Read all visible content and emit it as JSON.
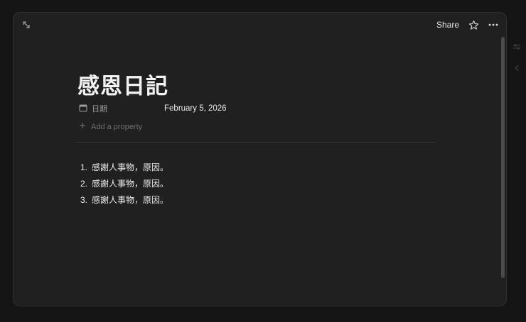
{
  "page": {
    "title": "感恩日記",
    "properties": [
      {
        "label": "日期",
        "value": "February 5, 2026",
        "icon": "calendar-icon"
      }
    ],
    "add_property_label": "Add a property"
  },
  "topbar": {
    "share_label": "Share",
    "expand_icon": "expand-arrows-icon",
    "favorite_icon": "star-icon",
    "more_icon": "more-dots-icon"
  },
  "list": {
    "items": [
      {
        "number": "1.",
        "text": "感謝人事物，原因。"
      },
      {
        "number": "2.",
        "text": "感謝人事物，原因。"
      },
      {
        "number": "3.",
        "text": "感謝人事物，原因。"
      }
    ]
  },
  "colors": {
    "modal_bg": "#202020",
    "backdrop": "#151515",
    "text": "#ececec",
    "muted": "#9b9b9b"
  }
}
